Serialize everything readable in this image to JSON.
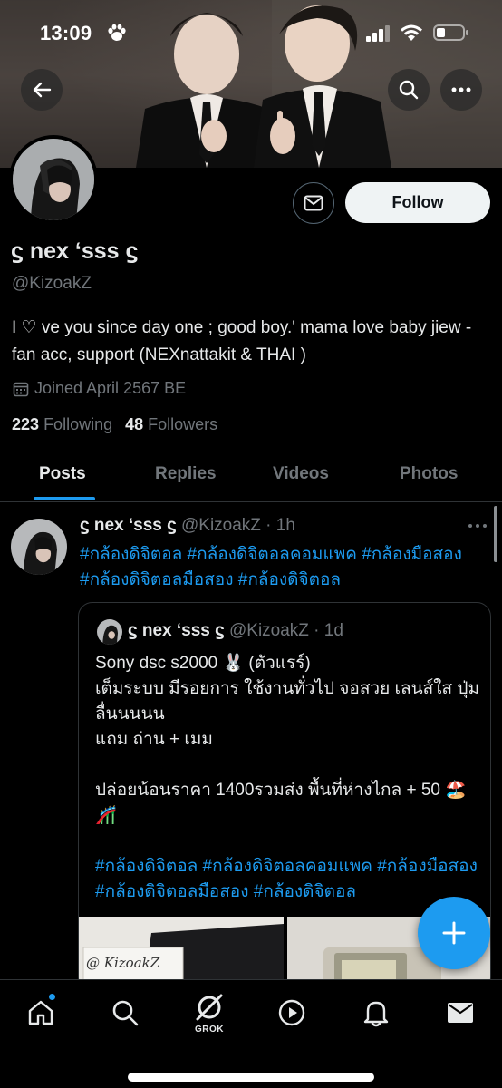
{
  "status_bar": {
    "time": "13:09"
  },
  "profile": {
    "display_name": "ϛ nex ‘sss ϛ",
    "handle": "@KizoakZ",
    "bio": "I ♡ ve you since day one ; good boy.' mama love baby jiew - fan acc, support (NEXnattakit & THAI )",
    "joined": "Joined April 2567 BE",
    "following_count": "223",
    "following_label": "Following",
    "followers_count": "48",
    "followers_label": "Followers",
    "follow_button": "Follow"
  },
  "tabs": [
    {
      "label": "Posts",
      "active": true
    },
    {
      "label": "Replies",
      "active": false
    },
    {
      "label": "Videos",
      "active": false
    },
    {
      "label": "Photos",
      "active": false
    }
  ],
  "post": {
    "name": "ϛ nex ‘sss ϛ",
    "handle_time": "@KizoakZ · 1h",
    "hashtags": "#กล้องดิจิตอล #กล้องดิจิตอลคอมแพค #กล้องมือสอง #กล้องดิจิตอลมือสอง #กล้องดิจิตอล",
    "quote": {
      "name": "ϛ nex ‘sss ϛ",
      "handle_time": "@KizoakZ · 1d",
      "line1": "Sony dsc s2000 🐰 (ตัวแรร์)",
      "line2": "เต็มระบบ มีรอยการ ใช้งานทั่วไป จอสวย เลนส์ใส ปุ่มลื่นนนนน",
      "line3": "แถม ถ่าน + เมม",
      "line4": "ปล่อยน้อนราคา  1400รวมส่ง พื้นที่ห่างไกล + 50 🏖️🎢",
      "hashtags": "#กล้องดิจิตอล #กล้องดิจิตอลคอมแพค #กล้องมือสอง #กล้องดิจิตอลมือสอง #กล้องดิจิตอล",
      "image_watermark": "@ KizoakZ"
    }
  },
  "bottom_nav": {
    "grok_label": "GROK"
  },
  "colors": {
    "accent": "#1d9bf0",
    "background": "#000000",
    "secondary_text": "#71767b",
    "border": "#2f3336"
  }
}
